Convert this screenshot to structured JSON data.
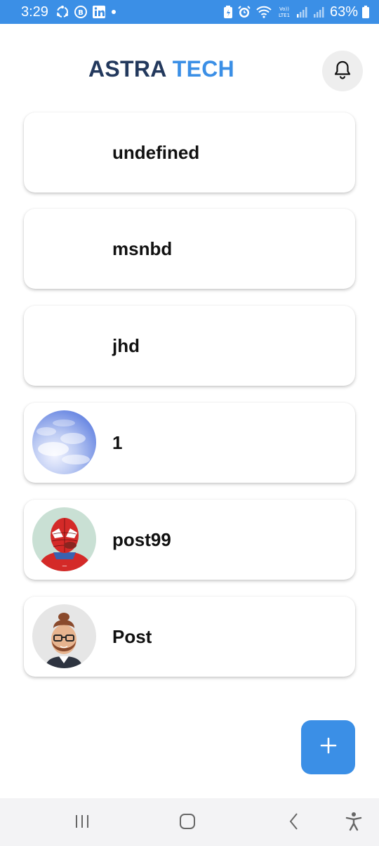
{
  "status_bar": {
    "time": "3:29",
    "battery": "63%"
  },
  "header": {
    "title_part1": "ASTRA",
    "title_part2": "TECH"
  },
  "posts": [
    {
      "label": "undefined",
      "has_image": false
    },
    {
      "label": "msnbd",
      "has_image": false
    },
    {
      "label": "jhd",
      "has_image": false
    },
    {
      "label": "1",
      "has_image": true,
      "image": "sky-clouds"
    },
    {
      "label": "post99",
      "has_image": true,
      "image": "spiderman-meme"
    },
    {
      "label": "Post",
      "has_image": true,
      "image": "bearded-avatar"
    }
  ],
  "fab": {
    "icon": "plus-icon"
  },
  "nav": {
    "items": [
      "recent-apps-icon",
      "home-icon",
      "back-icon",
      "accessibility-icon"
    ]
  },
  "colors": {
    "accent": "#3b8fe6",
    "title_dark": "#23395d"
  }
}
